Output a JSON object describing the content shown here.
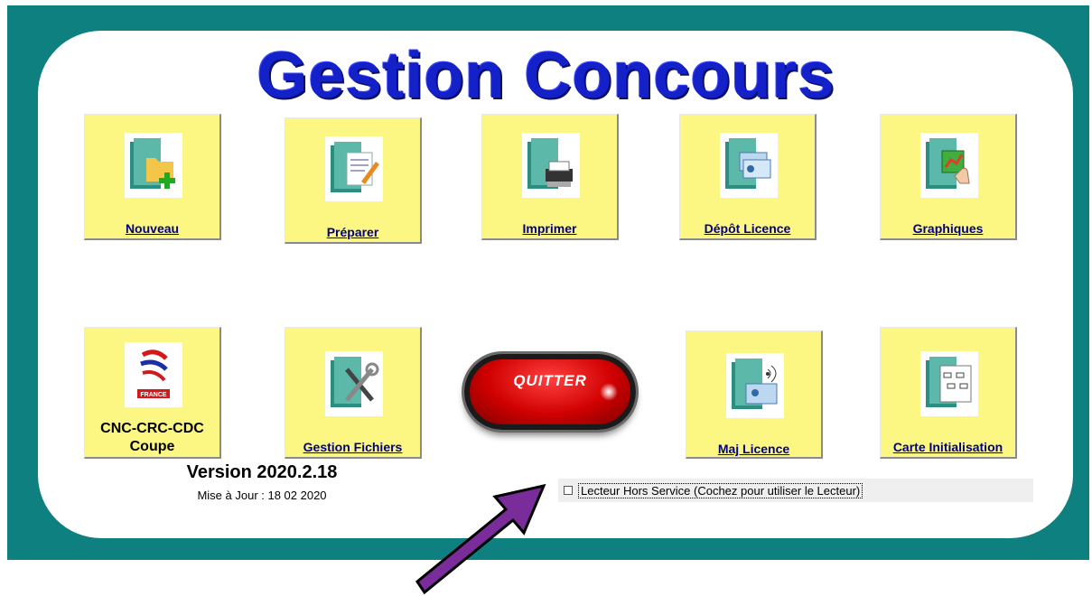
{
  "app": {
    "title": "Gestion Concours"
  },
  "tiles": {
    "nouveau": "Nouveau",
    "preparer": "Préparer",
    "imprimer": "Imprimer",
    "depot_licence": "Dépôt Licence",
    "graphiques": "Graphiques",
    "cnc_line1": "CNC-CRC-CDC",
    "cnc_line2": "Coupe",
    "gestion_fichiers": "Gestion Fichiers",
    "maj_licence": "Maj Licence",
    "carte_initialisation": "Carte Initialisation"
  },
  "quit_button": {
    "label": "QUITTER"
  },
  "version": {
    "label": "Version 2020.2.18",
    "update": "Mise à Jour : 18 02 2020"
  },
  "reader": {
    "checked": false,
    "label": "Lecteur Hors Service (Cochez pour utiliser le Lecteur)"
  },
  "colors": {
    "frame": "#0f8080",
    "title": "#1420c8",
    "tile": "#fcf782",
    "quit": "#d00000",
    "arrow": "#7b2c9b"
  },
  "logo_text": "FRANCE"
}
